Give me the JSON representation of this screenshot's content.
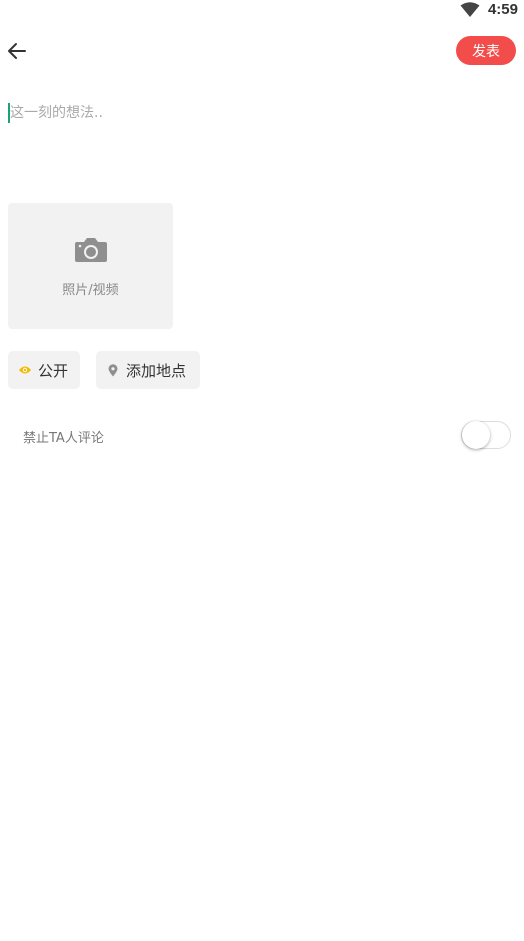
{
  "status_bar": {
    "time": "4:59",
    "wifi_icon": "wifi-icon"
  },
  "header": {
    "back_icon": "arrow-left-icon",
    "publish_label": "发表",
    "accent_color": "#f24d4b"
  },
  "composer": {
    "text_value": "",
    "placeholder": "这一刻的想法.."
  },
  "media_picker": {
    "icon": "camera-icon",
    "label": "照片/视频"
  },
  "chips": {
    "visibility": {
      "icon": "eye-icon",
      "label": "公开",
      "icon_color": "#f5b800"
    },
    "location": {
      "icon": "location-pin-icon",
      "label": "添加地点"
    }
  },
  "comment_setting": {
    "label": "禁止TA人评论",
    "enabled": false
  }
}
